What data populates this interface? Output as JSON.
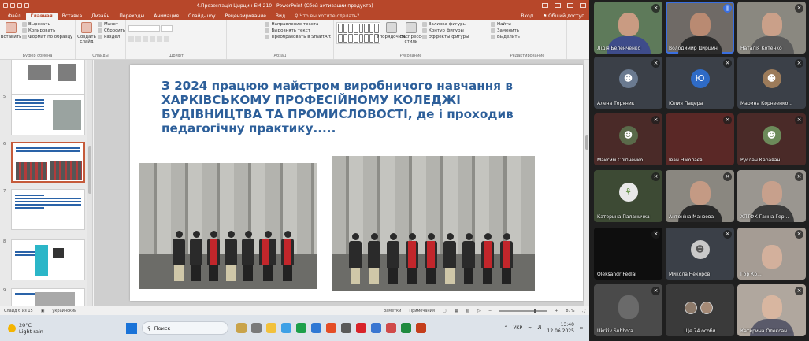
{
  "ppt": {
    "titlebar": {
      "title": "4.Презентація Цирцин ЕМ-210 - PowerPoint (Сбой активации продукта)"
    },
    "tabs": [
      "Файл",
      "Главная",
      "Вставка",
      "Дизайн",
      "Переходы",
      "Анимация",
      "Слайд-шоу",
      "Рецензирование",
      "Вид"
    ],
    "tellme": "Что вы хотите сделать?",
    "account": {
      "signin": "Вход",
      "share": "Общий доступ"
    },
    "ribbon": {
      "clipboard": {
        "paste": "Вставить",
        "cut": "Вырезать",
        "copy": "Копировать",
        "format_painter": "Формат по образцу",
        "label": "Буфер обмена"
      },
      "slides": {
        "new_slide": "Создать слайд",
        "layout": "Макет",
        "reset": "Сбросить",
        "section": "Раздел",
        "label": "Слайды"
      },
      "font": {
        "label": "Шрифт"
      },
      "paragraph": {
        "text_direction": "Направление текста",
        "align_text": "Выровнять текст",
        "smartart": "Преобразовать в SmartArt",
        "label": "Абзац"
      },
      "drawing": {
        "arrange": "Упорядочить",
        "quick_styles": "Экспресс-стили",
        "shape_fill": "Заливка фигуры",
        "shape_outline": "Контур фигуры",
        "shape_effects": "Эффекты фигуры",
        "label": "Рисование"
      },
      "editing": {
        "find": "Найти",
        "replace": "Заменить",
        "select": "Выделить",
        "label": "Редактирование"
      }
    },
    "thumbs": {
      "numbers": [
        "5",
        "6",
        "7",
        "8",
        "9"
      ]
    },
    "slide": {
      "title_prefix": "З 2024  ",
      "title_underlined": "працюю майстром виробничого",
      "title_rest": " навчання в ХАРКІВСЬКОМУ ПРОФЕСІЙНОМУ КОЛЕДЖІ БУДІВНИЦТВА ТА ПРОМИСЛОВОСТІ, де і проходив педагогічну практику....."
    },
    "status": {
      "slide_of": "Слайд 6 из 15",
      "language": "украинский",
      "notes": "Заметки",
      "comments": "Примечания",
      "zoom": "87%"
    }
  },
  "taskbar": {
    "weather_temp": "20°C",
    "weather_desc": "Light rain",
    "search_placeholder": "Поиск",
    "lang": "УКР",
    "time": "13:40",
    "date": "12.06.2025"
  },
  "conference": {
    "participants": [
      {
        "name": "Лідія Беленченко",
        "mic": "muted"
      },
      {
        "name": "Володимир Цирцин",
        "mic": "talking"
      },
      {
        "name": "Наталія Котенко",
        "mic": "muted"
      },
      {
        "name": "Алена Торяник",
        "mic": "muted"
      },
      {
        "name": "Юлия Пацера",
        "mic": "muted",
        "initial": "Ю"
      },
      {
        "name": "Марина Корнеенко...",
        "mic": "muted"
      },
      {
        "name": "Максим Сліпченко",
        "mic": "muted"
      },
      {
        "name": "Іван Ніколаєв",
        "mic": "muted"
      },
      {
        "name": "Руслан Караван",
        "mic": "muted"
      },
      {
        "name": "Катерина Паланичка",
        "mic": "muted"
      },
      {
        "name": "Антоніна Манзова",
        "mic": "muted"
      },
      {
        "name": "ХПТФК Ганна Гер...",
        "mic": "muted"
      },
      {
        "name": "Oleksandr Fedlai",
        "mic": "muted"
      },
      {
        "name": "Микола Некоров",
        "mic": "muted"
      },
      {
        "name": "Гор Кр...",
        "mic": "muted"
      },
      {
        "name": "Ukrkiv Subbota",
        "mic": "muted"
      },
      {
        "name": "Ще 74 особи",
        "mic": "none"
      },
      {
        "name": "Катерина Олексан...",
        "mic": "muted"
      }
    ]
  },
  "colors": {
    "ppt_accent": "#b7472a",
    "slide_title": "#2d5f9a",
    "active_speaker": "#3a6fe0"
  }
}
